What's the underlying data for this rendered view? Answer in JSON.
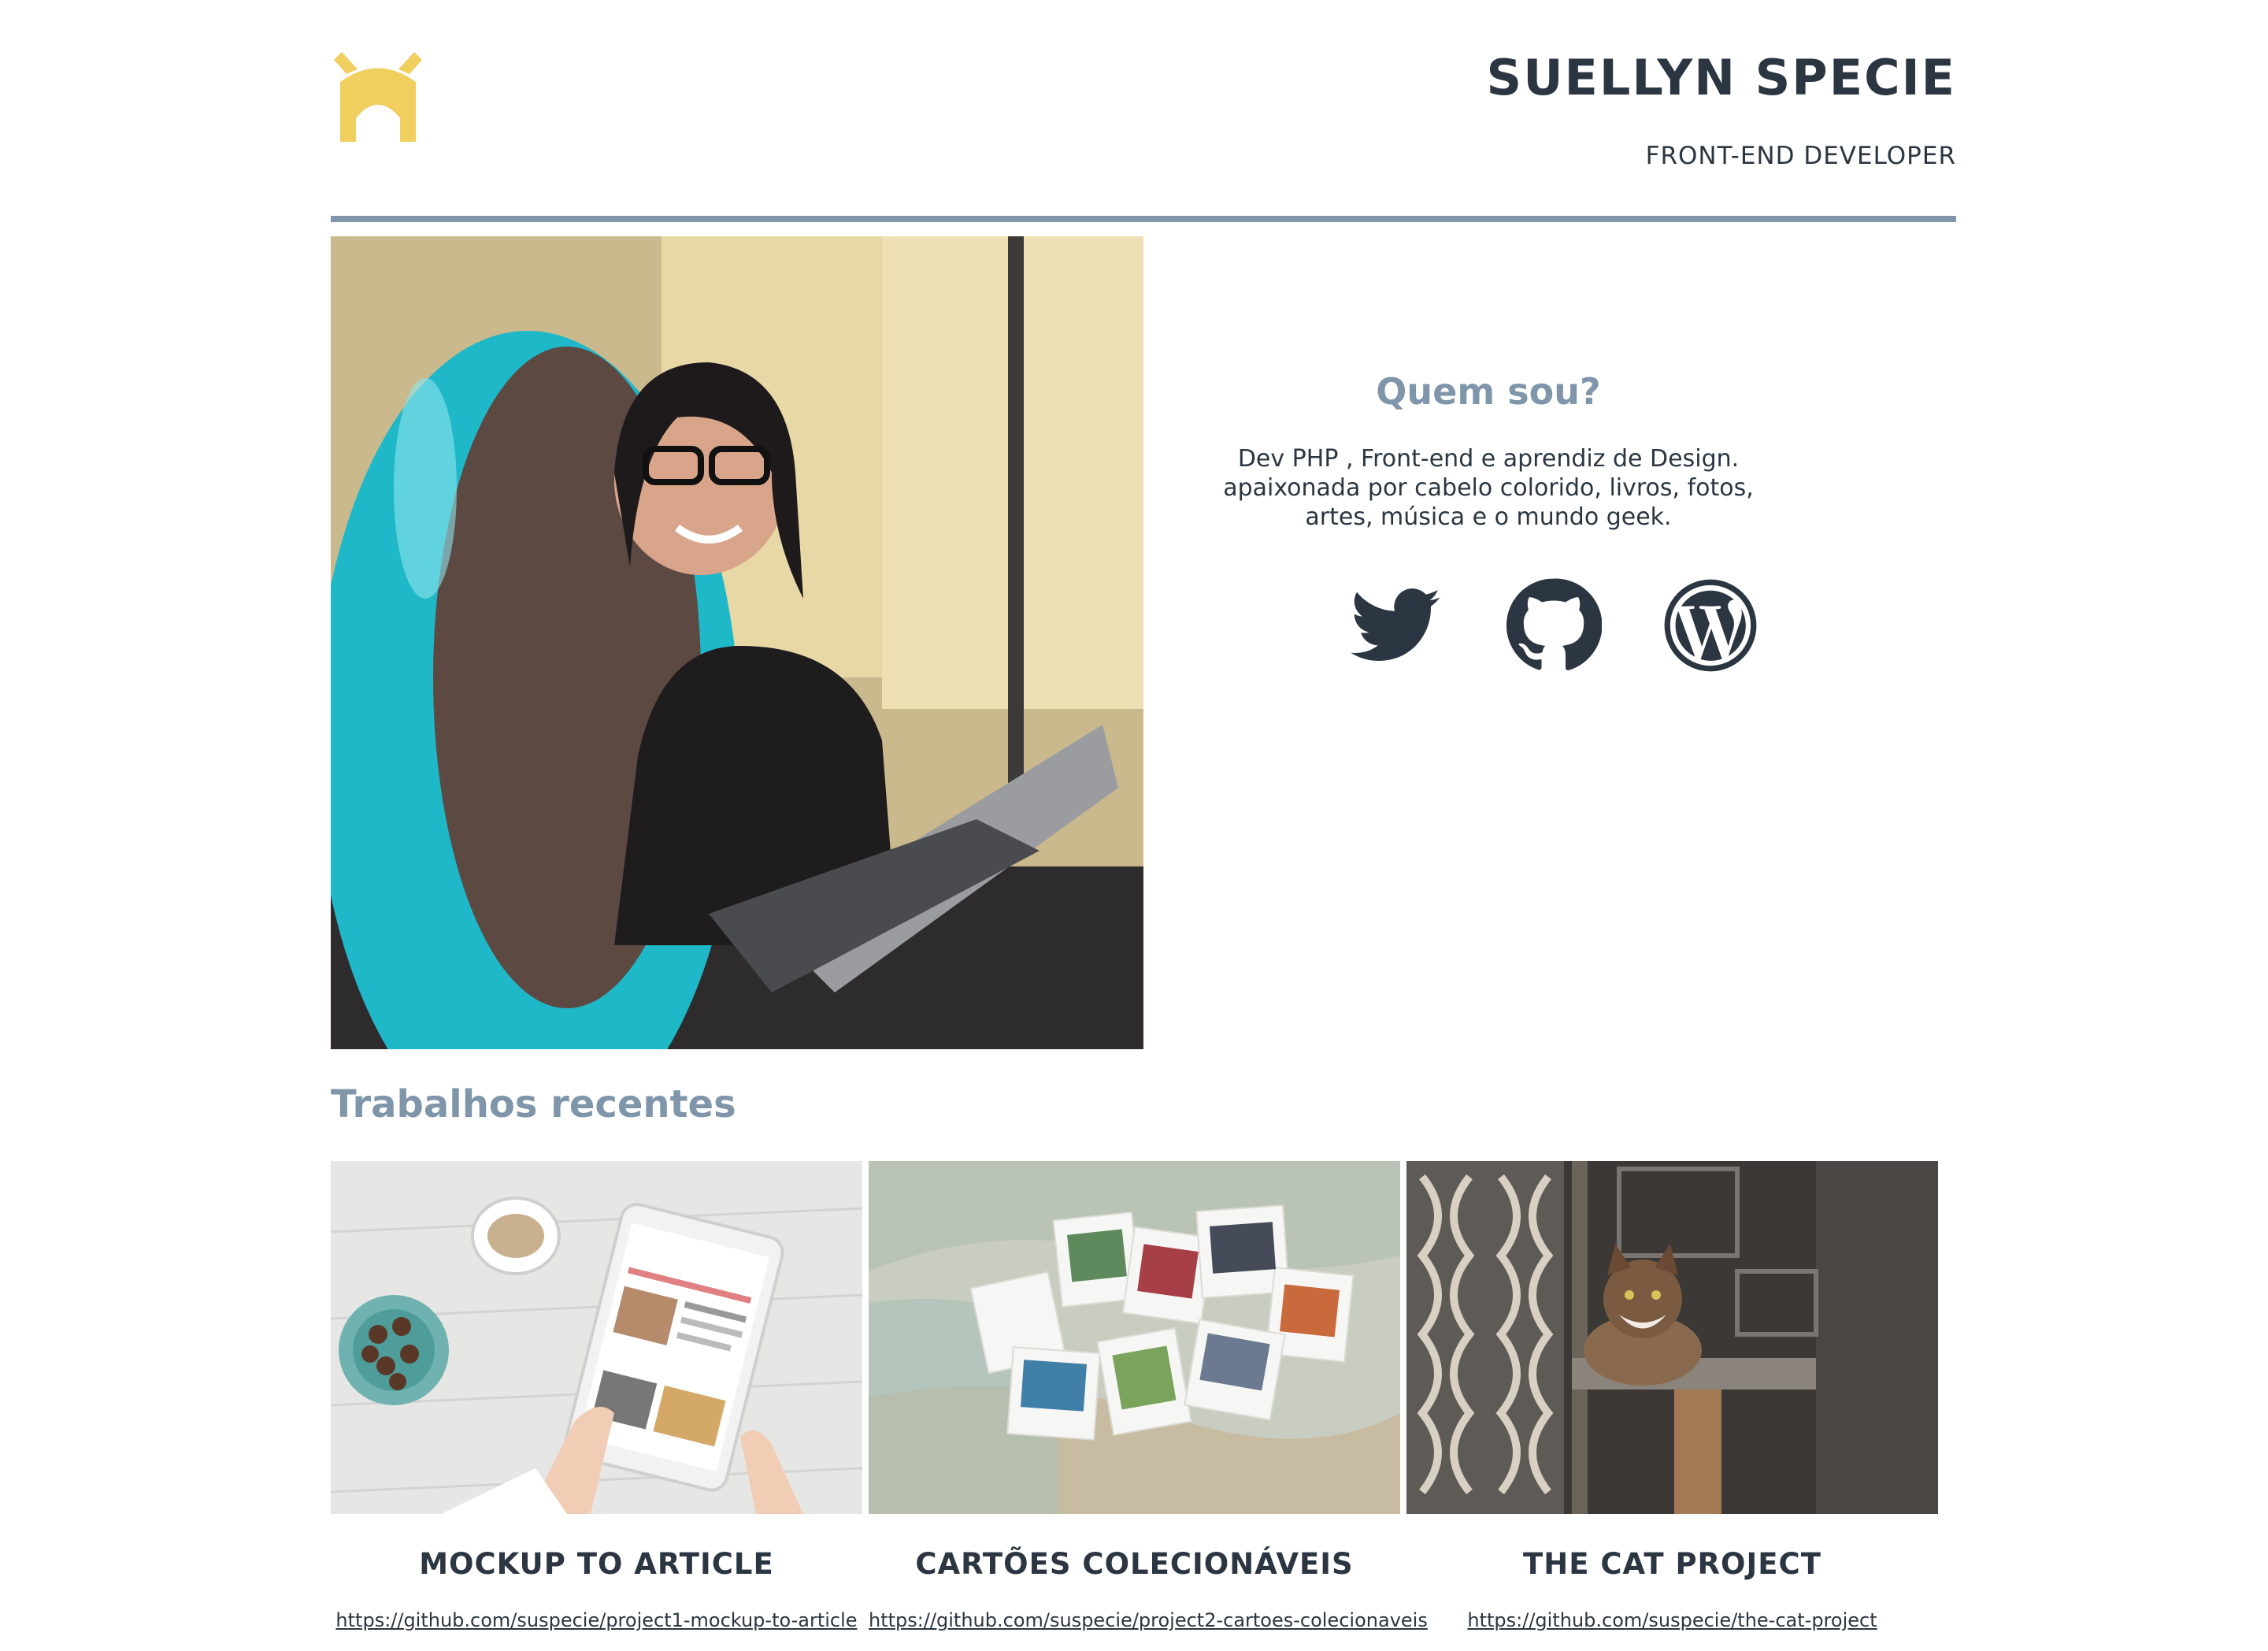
{
  "header": {
    "name": "SUELLYN SPECIE",
    "role": "FRONT-END DEVELOPER",
    "logo_icon": "yellow-horseshoe-logo",
    "logo_color": "#f0cf5e"
  },
  "colors": {
    "primary_text": "#2b3642",
    "accent": "#7f95a9",
    "logo": "#f0cf5e"
  },
  "about": {
    "title": "Quem sou?",
    "lines": [
      "Dev PHP , Front-end e aprendiz de Design.",
      "apaixonada por cabelo colorido, livros, fotos,",
      "artes, música e o mundo geek."
    ],
    "social": [
      {
        "icon": "twitter-icon",
        "label": "Twitter"
      },
      {
        "icon": "github-icon",
        "label": "GitHub"
      },
      {
        "icon": "wordpress-icon",
        "label": "WordPress"
      }
    ]
  },
  "works": {
    "title": "Trabalhos recentes",
    "items": [
      {
        "title": "MOCKUP TO ARTICLE",
        "link": "https://github.com/suspecie/project1-mockup-to-article"
      },
      {
        "title": "CARTÕES COLECIONÁVEIS",
        "link": "https://github.com/suspecie/project2-cartoes-colecionaveis"
      },
      {
        "title": "THE CAT PROJECT",
        "link": "https://github.com/suspecie/the-cat-project"
      }
    ]
  }
}
